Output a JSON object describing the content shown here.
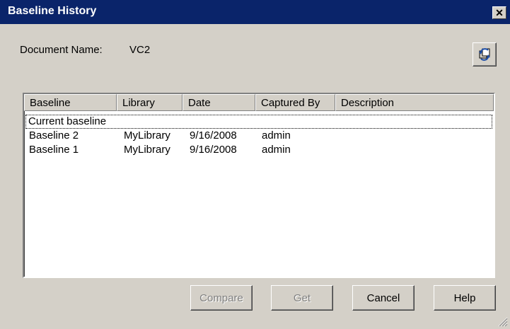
{
  "window": {
    "title": "Baseline History",
    "close_glyph": "✕"
  },
  "document": {
    "label": "Document Name:",
    "value": "VC2"
  },
  "toolbar": {
    "refresh_icon": "refresh-icon"
  },
  "list": {
    "columns": [
      "Baseline",
      "Library",
      "Date",
      "Captured By",
      "Description"
    ],
    "rows": [
      {
        "baseline": "Current baseline",
        "library": "",
        "date": "",
        "captured_by": "",
        "description": ""
      },
      {
        "baseline": "Baseline 2",
        "library": "MyLibrary",
        "date": "9/16/2008",
        "captured_by": "admin",
        "description": ""
      },
      {
        "baseline": "Baseline 1",
        "library": "MyLibrary",
        "date": "9/16/2008",
        "captured_by": "admin",
        "description": ""
      }
    ]
  },
  "buttons": {
    "compare": "Compare",
    "get": "Get",
    "cancel": "Cancel",
    "help": "Help"
  },
  "colors": {
    "titlebar": "#0a246a",
    "face": "#d4d0c8",
    "disabled_text": "#808080"
  }
}
